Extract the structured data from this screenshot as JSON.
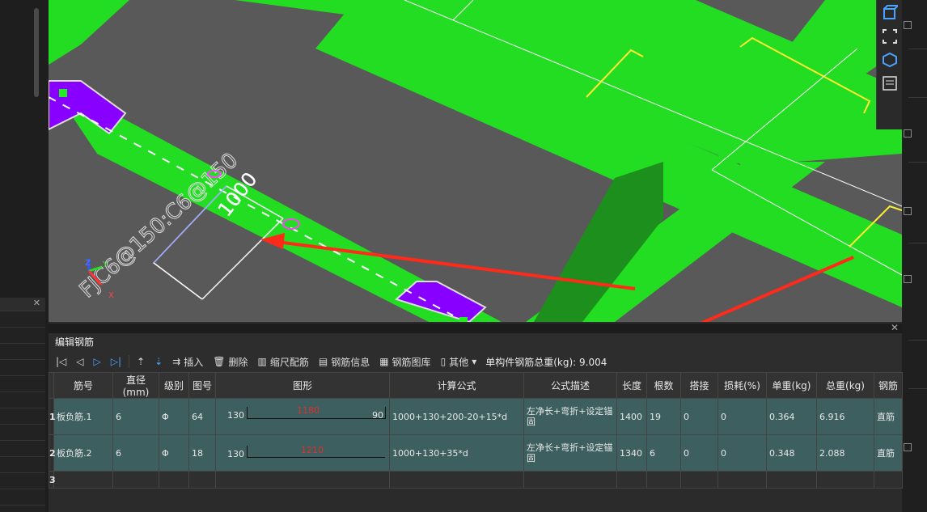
{
  "viewport": {
    "annotation_label": "FJC6@150:C6@150",
    "dimension_label": "1000",
    "axis_labels": {
      "z": "Z",
      "y": "Y",
      "x": "X"
    }
  },
  "panel": {
    "title": "编辑钢筋",
    "toolbar": {
      "insert": "插入",
      "delete": "删除",
      "scale_rebar": "缩尺配筋",
      "rebar_info": "钢筋信息",
      "rebar_library": "钢筋图库",
      "other": "其他",
      "total_weight": "单构件钢筋总重(kg): 9.004"
    },
    "columns": [
      "筋号",
      "直径(mm)",
      "级别",
      "图号",
      "图形",
      "计算公式",
      "公式描述",
      "长度",
      "根数",
      "搭接",
      "损耗(%)",
      "单重(kg)",
      "总重(kg)",
      "钢筋"
    ],
    "rows": [
      {
        "num": "1",
        "name": "板负筋.1",
        "diameter": "6",
        "grade": "Φ",
        "fig": "64",
        "shape_left": "130",
        "shape_mid": "1180",
        "shape_right": "90",
        "formula": "1000+130+200-20+15*d",
        "desc": "左净长+弯折+设定锚固",
        "length": "1400",
        "count": "19",
        "lap": "0",
        "loss": "0",
        "unit_w": "0.364",
        "total_w": "6.916",
        "type": "直筋"
      },
      {
        "num": "2",
        "name": "板负筋.2",
        "diameter": "6",
        "grade": "Φ",
        "fig": "18",
        "shape_left": "130",
        "shape_mid": "1210",
        "shape_right": "",
        "formula": "1000+130+35*d",
        "desc": "左净长+弯折+设定锚固",
        "length": "1340",
        "count": "6",
        "lap": "0",
        "loss": "0",
        "unit_w": "0.348",
        "total_w": "2.088",
        "type": "直筋"
      }
    ],
    "empty_row_num": "3"
  },
  "colors": {
    "beam": "#22dd22",
    "viewport_bg": "#595959",
    "highlight": "#8800ff",
    "arrow": "#ff2a1a",
    "row_bg": "#3d5f5f"
  }
}
